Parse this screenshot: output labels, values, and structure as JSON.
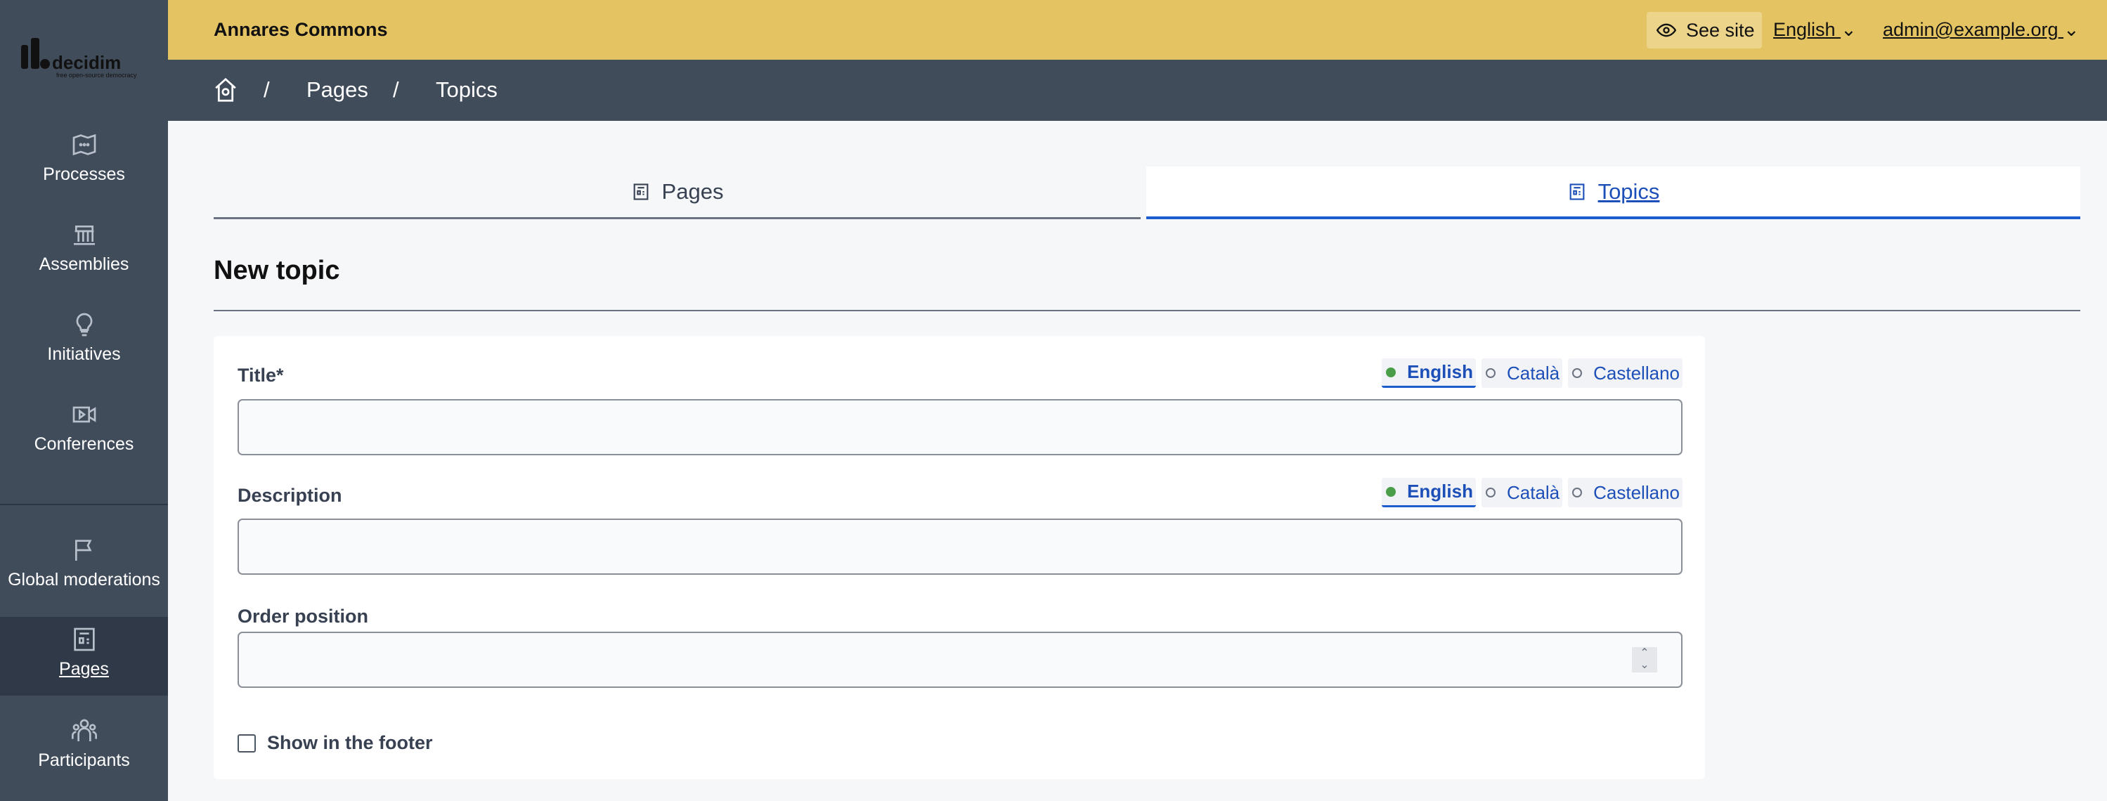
{
  "sidebar": {
    "logo_text": "decidim",
    "logo_tagline": "free open-source democracy",
    "items": [
      {
        "label": "Processes",
        "icon": "map-icon"
      },
      {
        "label": "Assemblies",
        "icon": "building-icon"
      },
      {
        "label": "Initiatives",
        "icon": "lightbulb-icon"
      },
      {
        "label": "Conferences",
        "icon": "video-icon"
      },
      {
        "label": "Global moderations",
        "icon": "flag-icon"
      },
      {
        "label": "Pages",
        "icon": "pages-icon",
        "active": true
      },
      {
        "label": "Participants",
        "icon": "participants-icon"
      }
    ]
  },
  "topbar": {
    "org": "Annares Commons",
    "see_site": "See site",
    "language": "English",
    "user": "admin@example.org"
  },
  "breadcrumb": {
    "sep": "/",
    "items": [
      "Pages",
      "Topics"
    ]
  },
  "tabs": [
    {
      "label": "Pages"
    },
    {
      "label": "Topics",
      "active": true
    }
  ],
  "page_title": "New topic",
  "form": {
    "languages": [
      "English",
      "Català",
      "Castellano"
    ],
    "title_label": "Title*",
    "title_value": "",
    "description_label": "Description",
    "description_value": "",
    "order_label": "Order position",
    "order_value": "",
    "footer_label": "Show in the footer",
    "footer_checked": false
  },
  "colors": {
    "topbar": "#e4c462",
    "sidebar": "#414c5b",
    "accent": "#1d5ccc",
    "active_lang_dot": "#4a9e4a"
  }
}
